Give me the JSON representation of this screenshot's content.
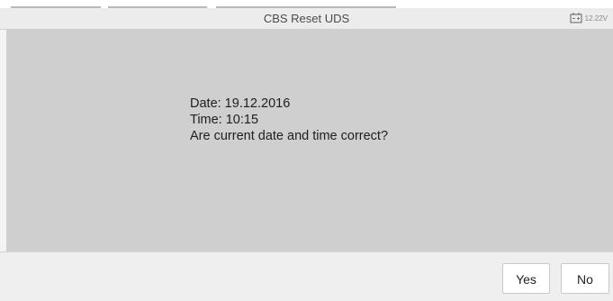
{
  "header": {
    "title": "CBS Reset UDS",
    "battery_voltage": "12.22V",
    "battery_icon": "battery-icon"
  },
  "message": {
    "date_line": "Date: 19.12.2016",
    "time_line": "Time: 10:15",
    "question_line": "Are current date and time correct?"
  },
  "buttons": {
    "yes_label": "Yes",
    "no_label": "No"
  },
  "colors": {
    "content_background": "#cfcfcf",
    "title_bar_background": "#ececec",
    "bottom_bar_background": "#efefef"
  }
}
